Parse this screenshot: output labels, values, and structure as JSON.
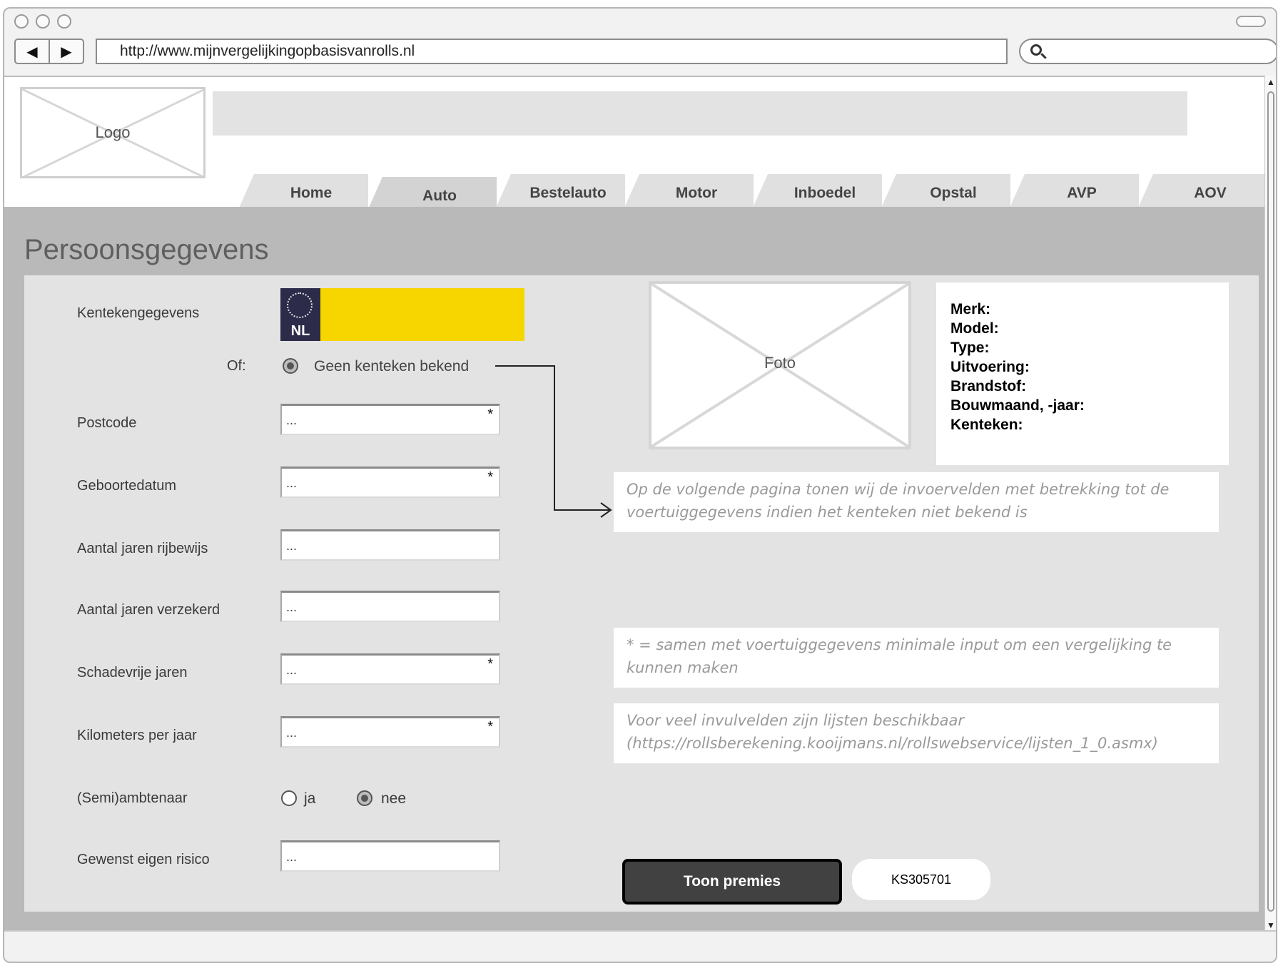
{
  "browser": {
    "url": "http://www.mijnvergelijkingopbasisvanrolls.nl",
    "back_glyph": "◀",
    "forward_glyph": "▶",
    "scroll_up_glyph": "▲",
    "scroll_down_glyph": "▼"
  },
  "header": {
    "logo_label": "Logo"
  },
  "tabs": [
    {
      "label": "Home",
      "active": false
    },
    {
      "label": "Auto",
      "active": true
    },
    {
      "label": "Bestelauto",
      "active": false
    },
    {
      "label": "Motor",
      "active": false
    },
    {
      "label": "Inboedel",
      "active": false
    },
    {
      "label": "Opstal",
      "active": false
    },
    {
      "label": "AVP",
      "active": false
    },
    {
      "label": "AOV",
      "active": false
    }
  ],
  "page": {
    "title": "Persoonsgegevens"
  },
  "form": {
    "kenteken_label": "Kentekengegevens",
    "plate_country": "NL",
    "of_label": "Of:",
    "geen_kenteken_label": "Geen kenteken bekend",
    "required_marker": "*",
    "fields": [
      {
        "label": "Postcode",
        "value": "...",
        "required": true
      },
      {
        "label": "Geboortedatum",
        "value": "...",
        "required": true
      },
      {
        "label": "Aantal jaren rijbewijs",
        "value": "...",
        "required": false
      },
      {
        "label": "Aantal jaren verzekerd",
        "value": "...",
        "required": false
      },
      {
        "label": "Schadevrije jaren",
        "value": "...",
        "required": true
      },
      {
        "label": "Kilometers per jaar",
        "value": "...",
        "required": true
      }
    ],
    "ambtenaar": {
      "label": "(Semi)ambtenaar",
      "option_ja": "ja",
      "option_nee": "nee",
      "selected": "nee"
    },
    "eigen_risico": {
      "label": "Gewenst eigen risico",
      "value": "..."
    }
  },
  "vehicle": {
    "foto_label": "Foto",
    "specs": [
      "Merk:",
      "Model:",
      "Type:",
      "Uitvoering:",
      "Brandstof:",
      "Bouwmaand, -jaar:",
      "Kenteken:"
    ]
  },
  "notes": {
    "volgende_pagina": "Op de volgende pagina tonen wij de invoervelden met betrekking tot de voertuiggegevens indien het kenteken niet bekend is",
    "minimale_input": "* = samen met voertuiggegevens minimale input om een vergelijking te kunnen maken",
    "lijsten": "Voor veel invulvelden zijn lijsten beschikbaar (https://rollsberekening.kooijmans.nl/rollswebservice/lijsten_1_0.asmx)"
  },
  "actions": {
    "toon_premies": "Toon premies",
    "reference": "KS305701"
  },
  "colors": {
    "plate_yellow": "#f7d600",
    "plate_blue": "#2c2c4a",
    "content_bg": "#b9b9b9",
    "panel_bg": "#e3e3e3"
  }
}
